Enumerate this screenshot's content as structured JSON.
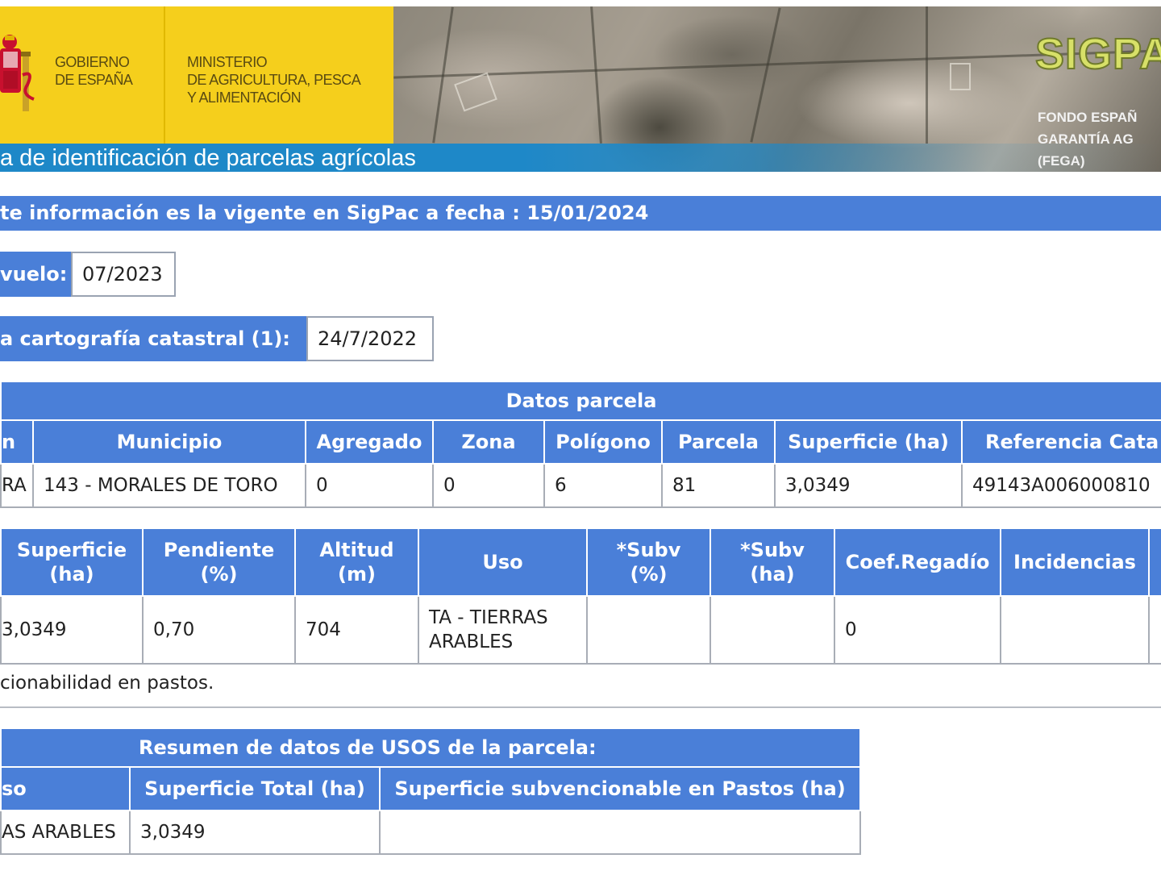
{
  "header": {
    "gov_label": "GOBIERNO\nDE ESPAÑA",
    "ministry_label": "MINISTERIO\nDE AGRICULTURA, PESCA\nY ALIMENTACIÓN",
    "subtitle": "a de identificación de parcelas agrícolas",
    "logo": "SIGPA",
    "fega": "FONDO ESPAÑ\nGARANTÍA AG\n(FEGA)"
  },
  "info": {
    "validity": "te información es la vigente en SigPac a fecha : 15/01/2024",
    "vuelo_label": "vuelo:",
    "vuelo_value": "07/2023",
    "catastral_label": "a cartografía catastral (1):",
    "catastral_value": "24/7/2022"
  },
  "parcela": {
    "caption": "Datos parcela",
    "headers": [
      "n",
      "Municipio",
      "Agregado",
      "Zona",
      "Polígono",
      "Parcela",
      "Superficie (ha)",
      "Referencia Cata"
    ],
    "row": [
      "RA",
      "143 - MORALES DE TORO",
      "0",
      "0",
      "6",
      "81",
      "3,0349",
      "49143A006000810"
    ]
  },
  "recinto": {
    "headers": [
      "Superficie\n(ha)",
      "Pendiente\n(%)",
      "Altitud\n(m)",
      "Uso",
      "*Subv\n(%)",
      "*Subv\n(ha)",
      "Coef.Regadío",
      "Incidencias",
      ""
    ],
    "row": [
      "3,0349",
      "0,70",
      "704",
      "TA - TIERRAS\nARABLES",
      "",
      "",
      "0",
      "",
      ""
    ]
  },
  "note": "cionabilidad en pastos.",
  "resumen": {
    "caption": "Resumen de datos de USOS de la parcela:",
    "headers": [
      "so",
      "Superficie Total (ha)",
      "Superficie subvencionable en Pastos (ha)"
    ],
    "row": [
      "AS ARABLES",
      "3,0349",
      ""
    ]
  },
  "colors": {
    "header_blue": "#4a7fd8",
    "gov_yellow": "#f5cf1c",
    "band_blue": "#1e88c8"
  }
}
